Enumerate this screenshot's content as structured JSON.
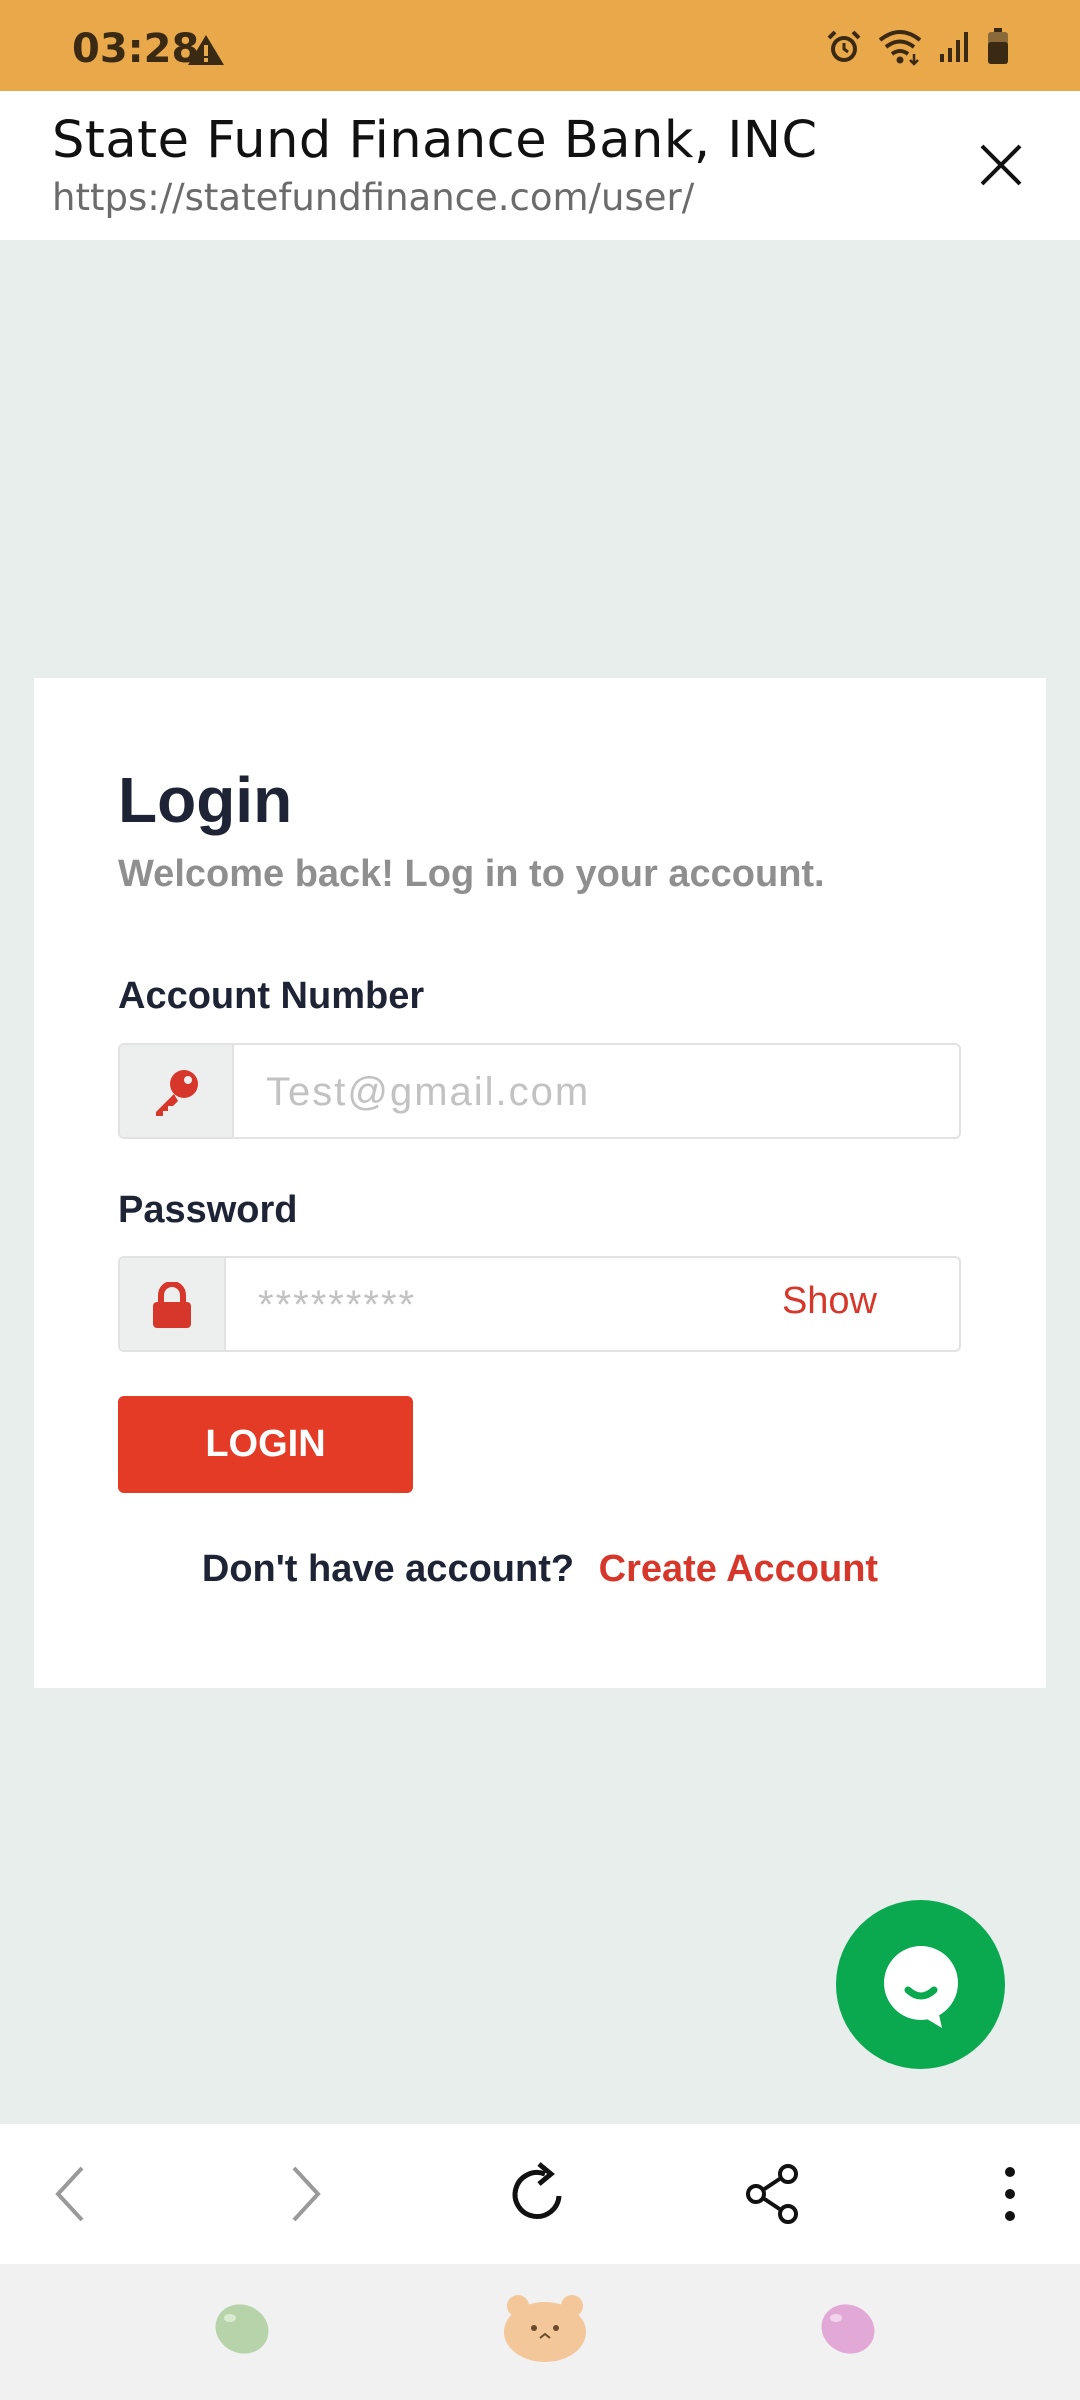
{
  "status_bar": {
    "time": "03:28"
  },
  "browser": {
    "title": "State Fund Finance Bank, INC",
    "url": "https://statefundfinance.com/user/"
  },
  "login": {
    "title": "Login",
    "subtitle": "Welcome back! Log in to your account.",
    "account_label": "Account Number",
    "account_placeholder": "Test@gmail.com",
    "password_label": "Password",
    "password_placeholder": "*********",
    "show_label": "Show",
    "login_button": "LOGIN",
    "signup_prompt": "Don't have account?",
    "signup_link": "Create Account"
  },
  "colors": {
    "status_bar": "#e9a94a",
    "accent": "#e43b26",
    "chat": "#0aa84f"
  },
  "icons": [
    "warning-icon",
    "alarm-icon",
    "wifi-icon",
    "signal-icon",
    "battery-icon",
    "close-icon",
    "key-icon",
    "lock-icon",
    "chat-icon",
    "back-icon",
    "forward-icon",
    "reload-icon",
    "share-icon",
    "more-icon"
  ]
}
